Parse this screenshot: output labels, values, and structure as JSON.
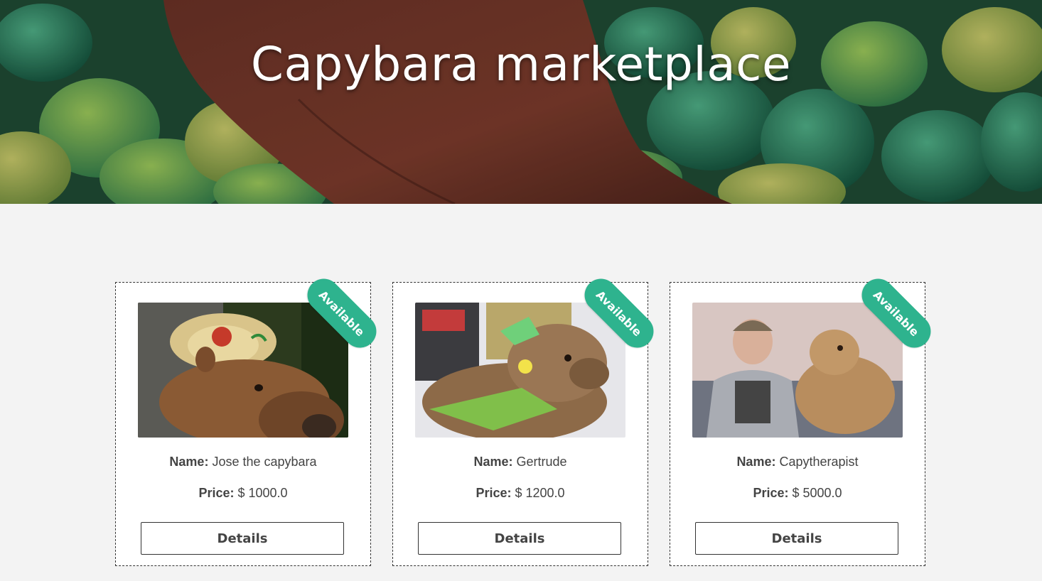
{
  "header": {
    "title": "Capybara marketplace"
  },
  "listings": [
    {
      "badge": "Available",
      "name_label": "Name:",
      "name": "Jose the capybara",
      "price_label": "Price:",
      "price": "$ 1000.0",
      "button": "Details",
      "photo": "capybara-with-sombrero"
    },
    {
      "badge": "Available",
      "name_label": "Name:",
      "name": "Gertrude",
      "price_label": "Price:",
      "price": "$ 1200.0",
      "button": "Details",
      "photo": "capybara-in-costume"
    },
    {
      "badge": "Available",
      "name_label": "Name:",
      "name": "Capytherapist",
      "price_label": "Price:",
      "price": "$ 5000.0",
      "button": "Details",
      "photo": "man-and-capybara-on-sofa"
    }
  ],
  "colors": {
    "badge": "#2eb38e",
    "page_background": "#f3f3f3",
    "text": "#444444"
  }
}
